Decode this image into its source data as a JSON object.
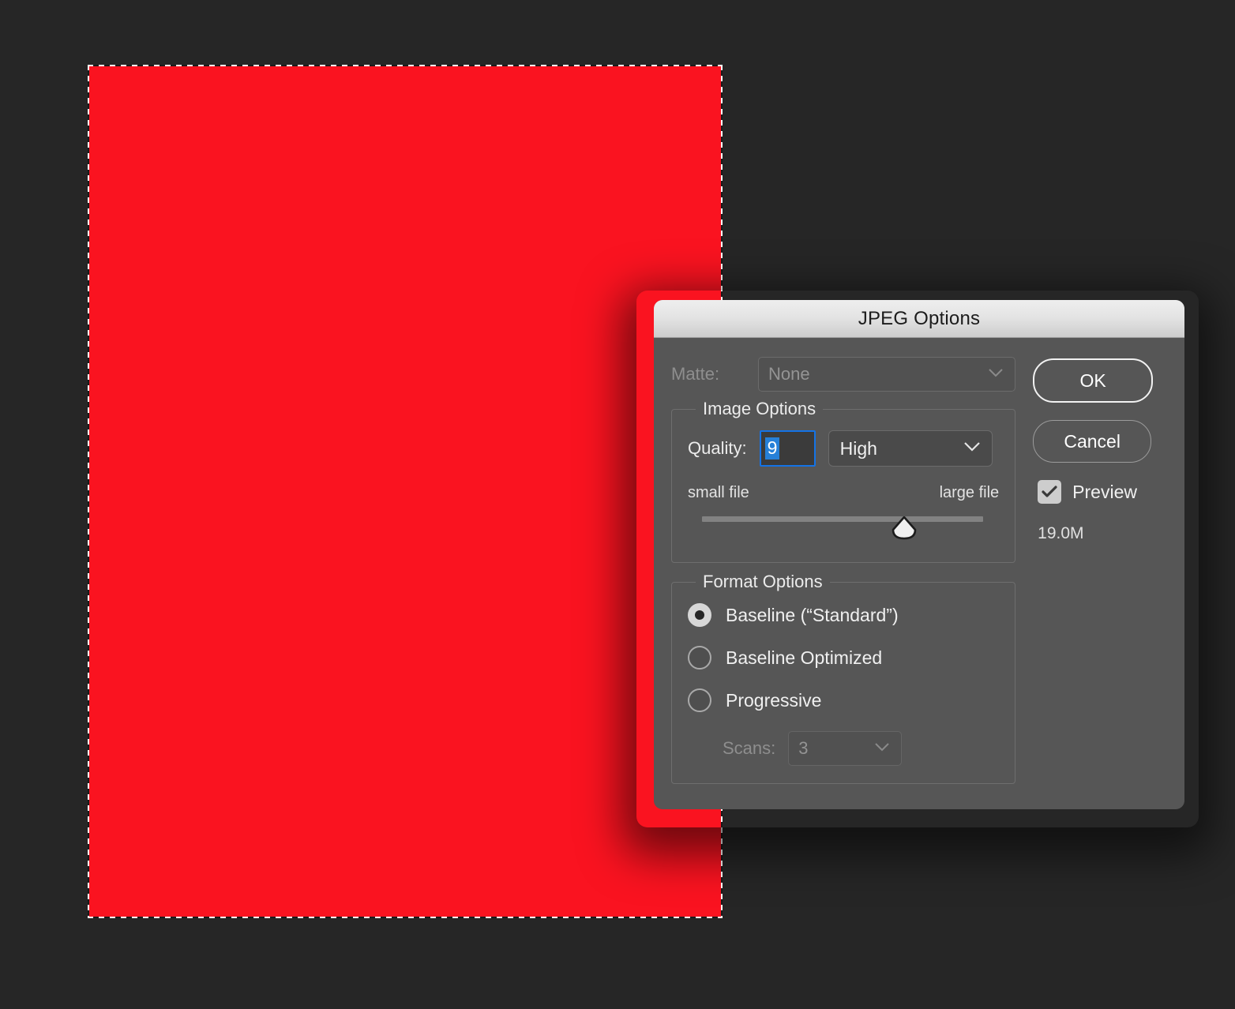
{
  "canvas": {
    "artwork_color": "#fa1320",
    "background_color": "#262626",
    "selection_name": "marching-ants-selection"
  },
  "dialog": {
    "title": "JPEG Options",
    "matte": {
      "label": "Matte:",
      "value": "None",
      "disabled": true
    },
    "image_options": {
      "legend": "Image Options",
      "quality_label": "Quality:",
      "quality_value": "9",
      "quality_preset": "High",
      "slider_min_label": "small file",
      "slider_max_label": "large file",
      "slider_percent": 72
    },
    "format_options": {
      "legend": "Format Options",
      "radios": [
        {
          "label": "Baseline (“Standard”)",
          "selected": true
        },
        {
          "label": "Baseline Optimized",
          "selected": false
        },
        {
          "label": "Progressive",
          "selected": false
        }
      ],
      "scans_label": "Scans:",
      "scans_value": "3",
      "scans_disabled": true
    },
    "buttons": {
      "ok": "OK",
      "cancel": "Cancel"
    },
    "preview": {
      "label": "Preview",
      "checked": true
    },
    "file_size": "19.0M",
    "colors": {
      "dialog_bg": "#565656",
      "titlebar_top": "#eeeeee",
      "titlebar_bottom": "#cdcdcd",
      "focus_ring": "#1473e6",
      "selection_highlight": "#2680d8"
    }
  }
}
